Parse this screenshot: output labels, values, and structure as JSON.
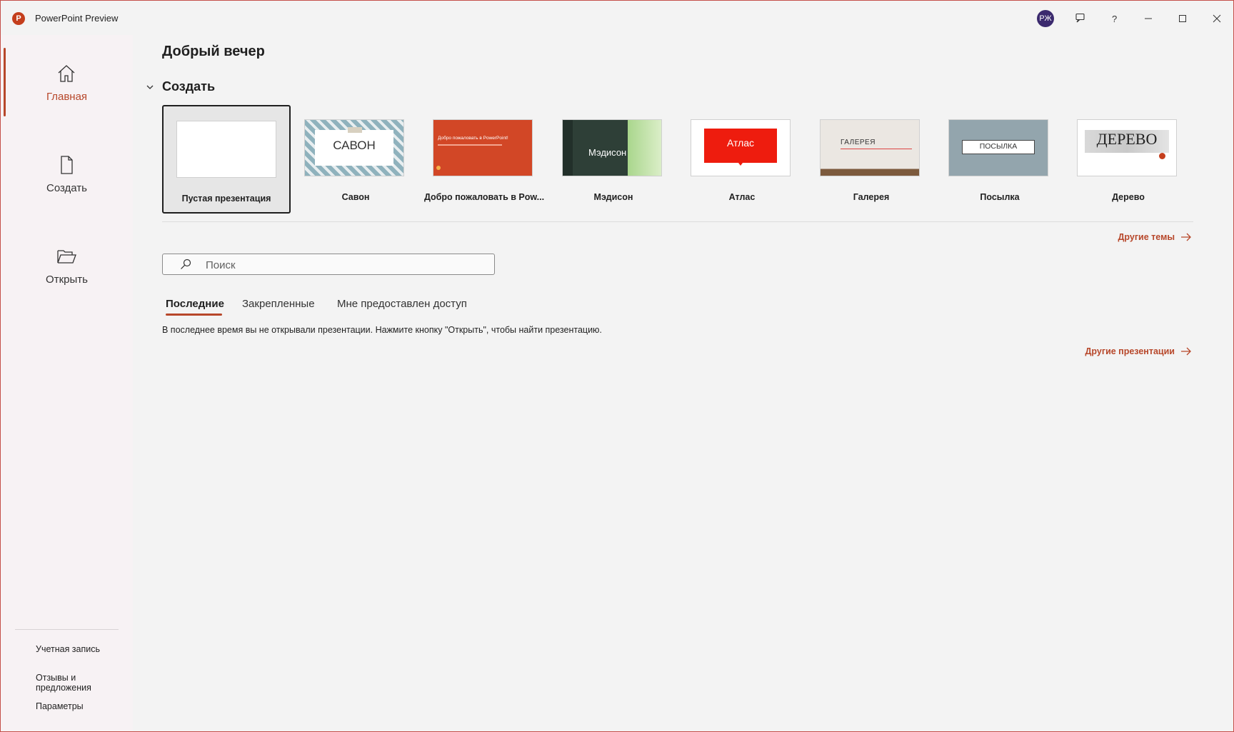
{
  "app": {
    "title": "PowerPoint Preview",
    "logo_letter": "P",
    "avatar_initials": "РЖ"
  },
  "sidebar": {
    "items": [
      {
        "label": "Главная",
        "icon": "home-icon",
        "active": true
      },
      {
        "label": "Создать",
        "icon": "new-document-icon",
        "active": false
      },
      {
        "label": "Открыть",
        "icon": "folder-open-icon",
        "active": false
      }
    ],
    "bottom_links": [
      "Учетная запись",
      "Отзывы и предложения",
      "Параметры"
    ]
  },
  "main": {
    "greeting": "Добрый вечер",
    "section_title": "Создать",
    "templates": [
      {
        "label": "Пустая презентация"
      },
      {
        "label": "Савон",
        "thumb_text": "САВОН"
      },
      {
        "label": "Добро пожаловать в Pow...",
        "thumb_text": "Добро пожаловать в PowerPoint!"
      },
      {
        "label": "Мэдисон",
        "thumb_text": "Мэдисон"
      },
      {
        "label": "Атлас",
        "thumb_text": "Атлас"
      },
      {
        "label": "Галерея",
        "thumb_text": "ГАЛЕРЕЯ"
      },
      {
        "label": "Посылка",
        "thumb_text": "ПОСЫЛКА"
      },
      {
        "label": "Дерево",
        "thumb_text": "ДЕРЕВО"
      }
    ],
    "more_themes": "Другие темы",
    "search_placeholder": "Поиск",
    "tabs": [
      {
        "label": "Последние",
        "active": true
      },
      {
        "label": "Закрепленные",
        "active": false
      },
      {
        "label": "Мне предоставлен доступ",
        "active": false
      }
    ],
    "empty_message": "В последнее время вы не открывали презентации. Нажмите кнопку \"Открыть\", чтобы найти презентацию.",
    "more_presentations": "Другие презентации"
  },
  "colors": {
    "accent": "#b7472a",
    "sidebar_bg": "#f7f2f4",
    "main_bg": "#f3f3f3"
  }
}
